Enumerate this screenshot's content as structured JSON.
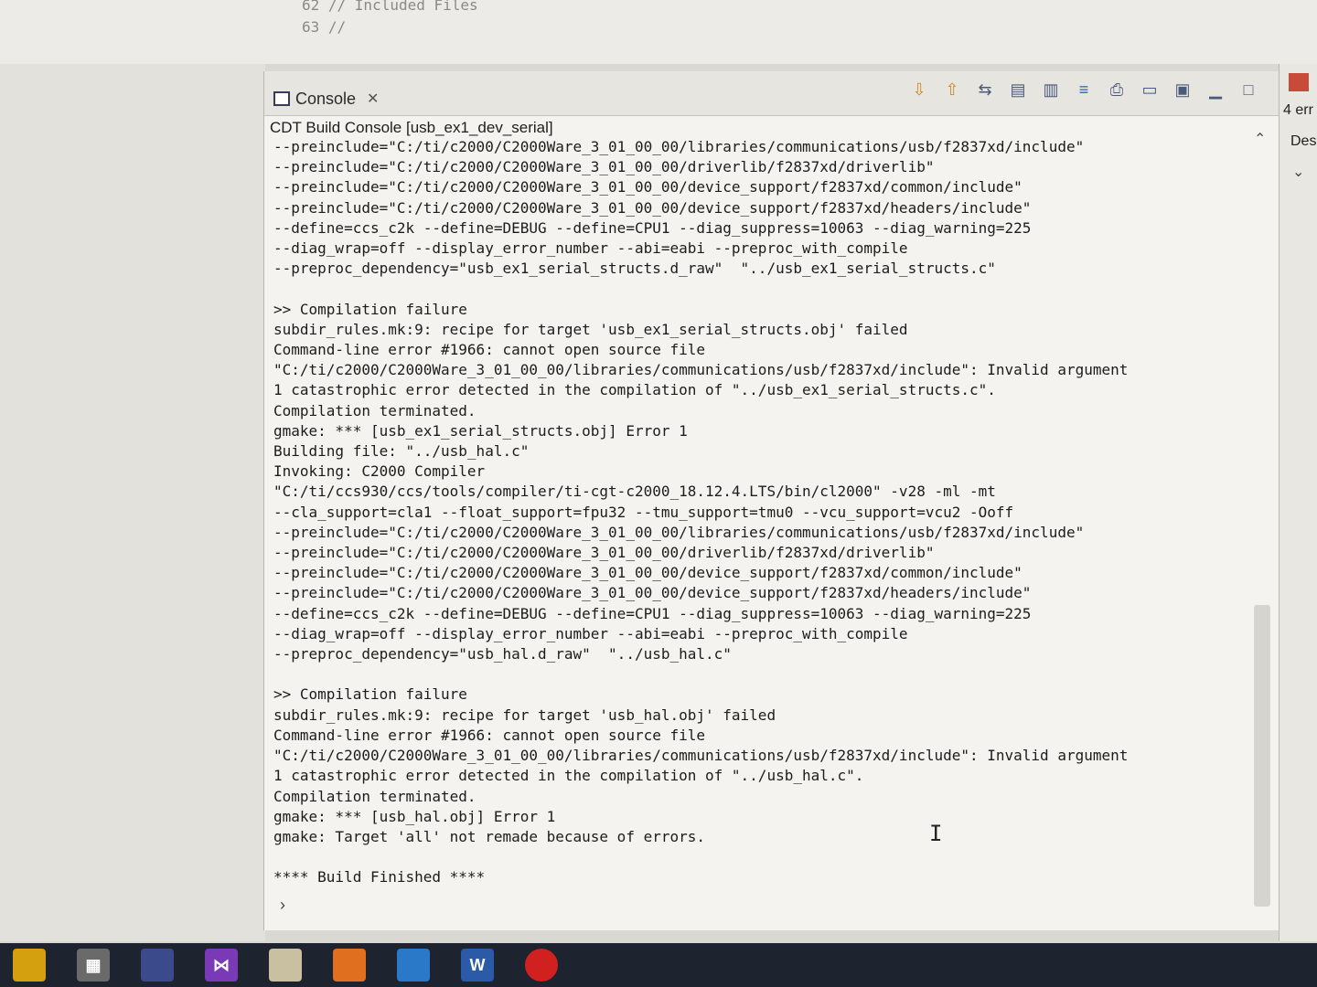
{
  "editor": {
    "lines": [
      "62 // Included Files",
      "63 //"
    ]
  },
  "console": {
    "tab_label": "Console",
    "subtitle": "CDT Build Console [usb_ex1_dev_serial]",
    "output_lines": [
      "--preinclude=\"C:/ti/c2000/C2000Ware_3_01_00_00/libraries/communications/usb/f2837xd/include\"",
      "--preinclude=\"C:/ti/c2000/C2000Ware_3_01_00_00/driverlib/f2837xd/driverlib\"",
      "--preinclude=\"C:/ti/c2000/C2000Ware_3_01_00_00/device_support/f2837xd/common/include\"",
      "--preinclude=\"C:/ti/c2000/C2000Ware_3_01_00_00/device_support/f2837xd/headers/include\"",
      "--define=ccs_c2k --define=DEBUG --define=CPU1 --diag_suppress=10063 --diag_warning=225",
      "--diag_wrap=off --display_error_number --abi=eabi --preproc_with_compile",
      "--preproc_dependency=\"usb_ex1_serial_structs.d_raw\"  \"../usb_ex1_serial_structs.c\"",
      "",
      ">> Compilation failure",
      "subdir_rules.mk:9: recipe for target 'usb_ex1_serial_structs.obj' failed",
      "Command-line error #1966: cannot open source file",
      "\"C:/ti/c2000/C2000Ware_3_01_00_00/libraries/communications/usb/f2837xd/include\": Invalid argument",
      "1 catastrophic error detected in the compilation of \"../usb_ex1_serial_structs.c\".",
      "Compilation terminated.",
      "gmake: *** [usb_ex1_serial_structs.obj] Error 1",
      "Building file: \"../usb_hal.c\"",
      "Invoking: C2000 Compiler",
      "\"C:/ti/ccs930/ccs/tools/compiler/ti-cgt-c2000_18.12.4.LTS/bin/cl2000\" -v28 -ml -mt",
      "--cla_support=cla1 --float_support=fpu32 --tmu_support=tmu0 --vcu_support=vcu2 -Ooff",
      "--preinclude=\"C:/ti/c2000/C2000Ware_3_01_00_00/libraries/communications/usb/f2837xd/include\"",
      "--preinclude=\"C:/ti/c2000/C2000Ware_3_01_00_00/driverlib/f2837xd/driverlib\"",
      "--preinclude=\"C:/ti/c2000/C2000Ware_3_01_00_00/device_support/f2837xd/common/include\"",
      "--preinclude=\"C:/ti/c2000/C2000Ware_3_01_00_00/device_support/f2837xd/headers/include\"",
      "--define=ccs_c2k --define=DEBUG --define=CPU1 --diag_suppress=10063 --diag_warning=225",
      "--diag_wrap=off --display_error_number --abi=eabi --preproc_with_compile",
      "--preproc_dependency=\"usb_hal.d_raw\"  \"../usb_hal.c\"",
      "",
      ">> Compilation failure",
      "subdir_rules.mk:9: recipe for target 'usb_hal.obj' failed",
      "Command-line error #1966: cannot open source file",
      "\"C:/ti/c2000/C2000Ware_3_01_00_00/libraries/communications/usb/f2837xd/include\": Invalid argument",
      "1 catastrophic error detected in the compilation of \"../usb_hal.c\".",
      "Compilation terminated.",
      "gmake: *** [usb_hal.obj] Error 1",
      "gmake: Target 'all' not remade because of errors.",
      "",
      "**** Build Finished ****"
    ]
  },
  "right_panel": {
    "errors_label": "4 err",
    "des_label": "Des"
  }
}
